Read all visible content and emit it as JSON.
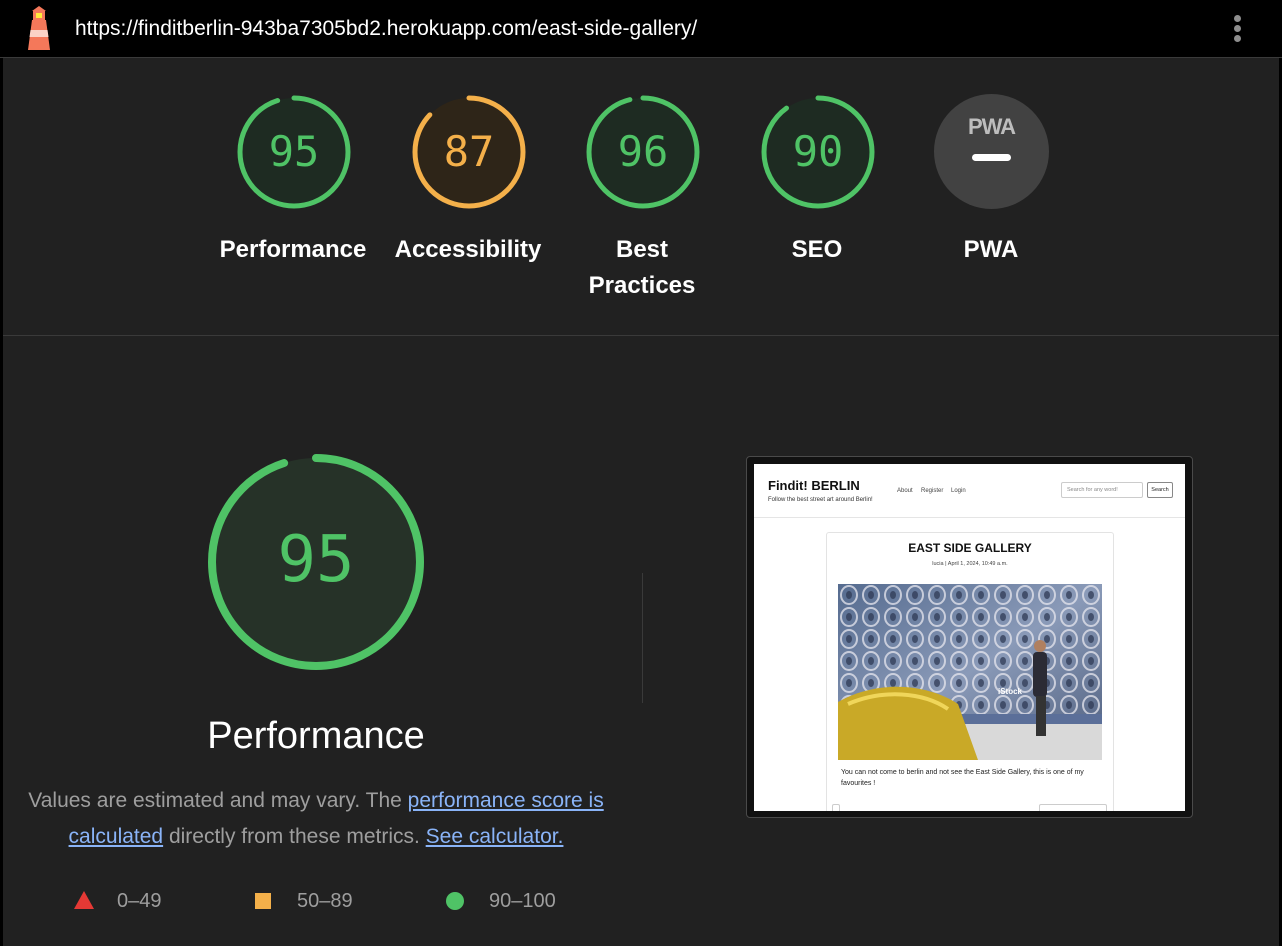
{
  "topbar": {
    "url": "https://finditberlin-943ba7305bd2.herokuapp.com/east-side-gallery/"
  },
  "categories": [
    {
      "label": "Performance",
      "score": "95",
      "status": "pass"
    },
    {
      "label": "Accessibility",
      "score": "87",
      "status": "average"
    },
    {
      "label": "Best Practices",
      "score": "96",
      "status": "pass"
    },
    {
      "label": "SEO",
      "score": "90",
      "status": "pass"
    },
    {
      "label": "PWA",
      "badge": "PWA",
      "status": "na"
    }
  ],
  "colors": {
    "pass": "#4fc366",
    "average": "#f4b04a",
    "fail": "#e53935",
    "pass_fill": "#1e2b22",
    "average_fill": "#2e2518"
  },
  "detail": {
    "score": "95",
    "title": "Performance",
    "desc_prefix": "Values are estimated and may vary. The ",
    "link_score": "performance score is calculated",
    "desc_middle": " directly from these metrics. ",
    "link_calc": "See calculator."
  },
  "legend": [
    {
      "range": "0–49",
      "shape": "triangle"
    },
    {
      "range": "50–89",
      "shape": "square"
    },
    {
      "range": "90–100",
      "shape": "circle"
    }
  ],
  "screenshot": {
    "brand": "Findit! BERLIN",
    "tagline": "Follow the best street art around Berlin!",
    "nav": [
      "About",
      "Register",
      "Login"
    ],
    "search_placeholder": "Search for any word!",
    "search_button": "Search",
    "post_title": "EAST SIDE GALLERY",
    "post_meta": "lucia | April 1, 2024, 10:49 a.m.",
    "watermark": "iStock",
    "post_body": "You can not come to berlin and not see the East Side Gallery, this is one of my favourites !"
  }
}
